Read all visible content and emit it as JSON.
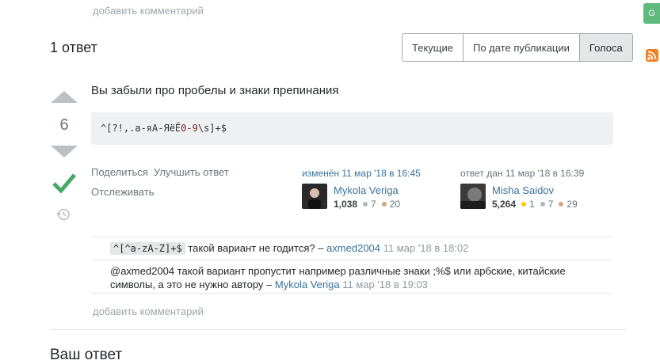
{
  "top": {
    "add_comment": "добавить комментарий"
  },
  "answers": {
    "count_label": "1 ответ",
    "tabs": [
      "Текущие",
      "По дате публикации",
      "Голоса"
    ],
    "active_tab": "Голоса"
  },
  "answer": {
    "votes": "6",
    "text": "Вы забыли про пробелы и знаки препинания",
    "code": {
      "part1": "^[?!,.а-яА-ЯёЁ",
      "part2": "0-9",
      "part3": "\\s]+$"
    },
    "menu": {
      "share": "Поделиться",
      "improve": "Улучшить ответ",
      "follow": "Отслеживать"
    },
    "edited": {
      "action": "изменён 11 мар '18 в 16:45",
      "user": "Mykola Veriga",
      "rep": "1,038",
      "silver": "7",
      "bronze": "20"
    },
    "author": {
      "action": "ответ дан 11 мар '18 в 16:39",
      "user": "Misha Saidov",
      "rep": "5,264",
      "gold": "1",
      "silver": "7",
      "bronze": "29"
    }
  },
  "comments": [
    {
      "code": "^[^a-zA-Z]+$",
      "text": "такой вариант не годится? –",
      "user": "axmed2004",
      "date": "11 мар '18 в 18:02"
    },
    {
      "text": "@axmed2004 такой вариант пропустит например различные знаки ;%$ или арбские, китайские символы, а это не нужно автору –",
      "user": "Mykola Veriga",
      "date": "11 мар '18 в 19:03"
    }
  ],
  "add_comment": "добавить комментарий",
  "your_answer": "Ваш ответ",
  "colors": {
    "accent": "#39739d",
    "accepted": "#48a868",
    "vote_arrow": "#bbc0c4"
  }
}
